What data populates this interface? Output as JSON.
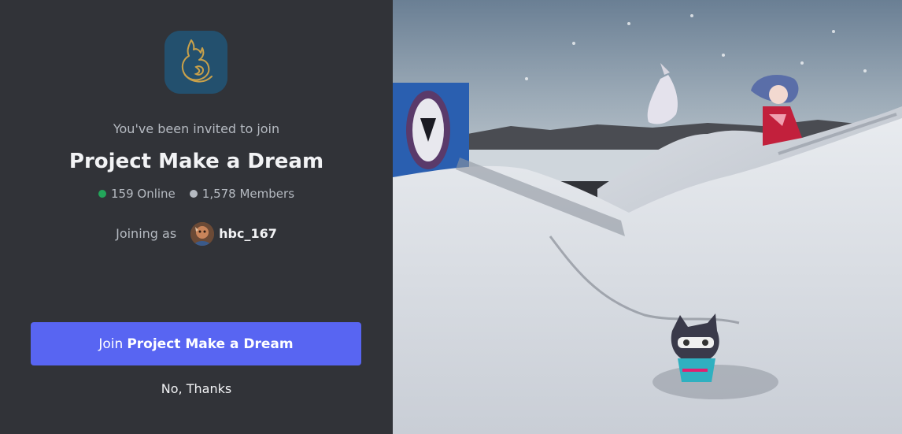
{
  "invite": {
    "invited_text": "You've been invited to join",
    "server_name": "Project Make a Dream",
    "online_count": "159 Online",
    "member_count": "1,578 Members",
    "joining_label": "Joining as",
    "username": "hbc_167",
    "join_prefix": "Join",
    "join_server": "Project Make a Dream",
    "decline_label": "No, Thanks"
  },
  "colors": {
    "background": "#313338",
    "accent": "#5865f2",
    "online": "#23a55a",
    "server_icon_bg": "#23506e"
  },
  "icons": {
    "server_icon": "fox-logo-icon",
    "online_indicator": "online-dot-icon",
    "members_indicator": "members-dot-icon"
  }
}
